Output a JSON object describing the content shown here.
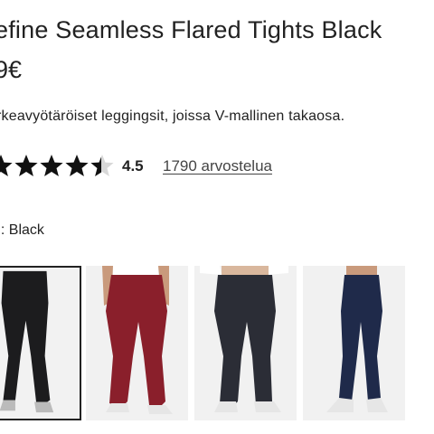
{
  "product": {
    "title": "efine Seamless Flared Tights Black",
    "price": "9€",
    "description": "rkeavyötäröiset leggingsit, joissa V-mallinen takaosa."
  },
  "rating": {
    "value": "4.5",
    "stars_filled": 4.5,
    "stars_total": 5,
    "reviews_link": "1790 arvostelua",
    "star_icon": "star-icon"
  },
  "color": {
    "label": "ri: Black"
  },
  "swatches": [
    {
      "name": "Black",
      "color": "#1c1c1e",
      "selected": true
    },
    {
      "name": "Burgundy",
      "color": "#8a1f2b",
      "selected": false
    },
    {
      "name": "Charcoal",
      "color": "#2b2d36",
      "selected": false
    },
    {
      "name": "Navy",
      "color": "#1f2a4a",
      "selected": false
    }
  ]
}
